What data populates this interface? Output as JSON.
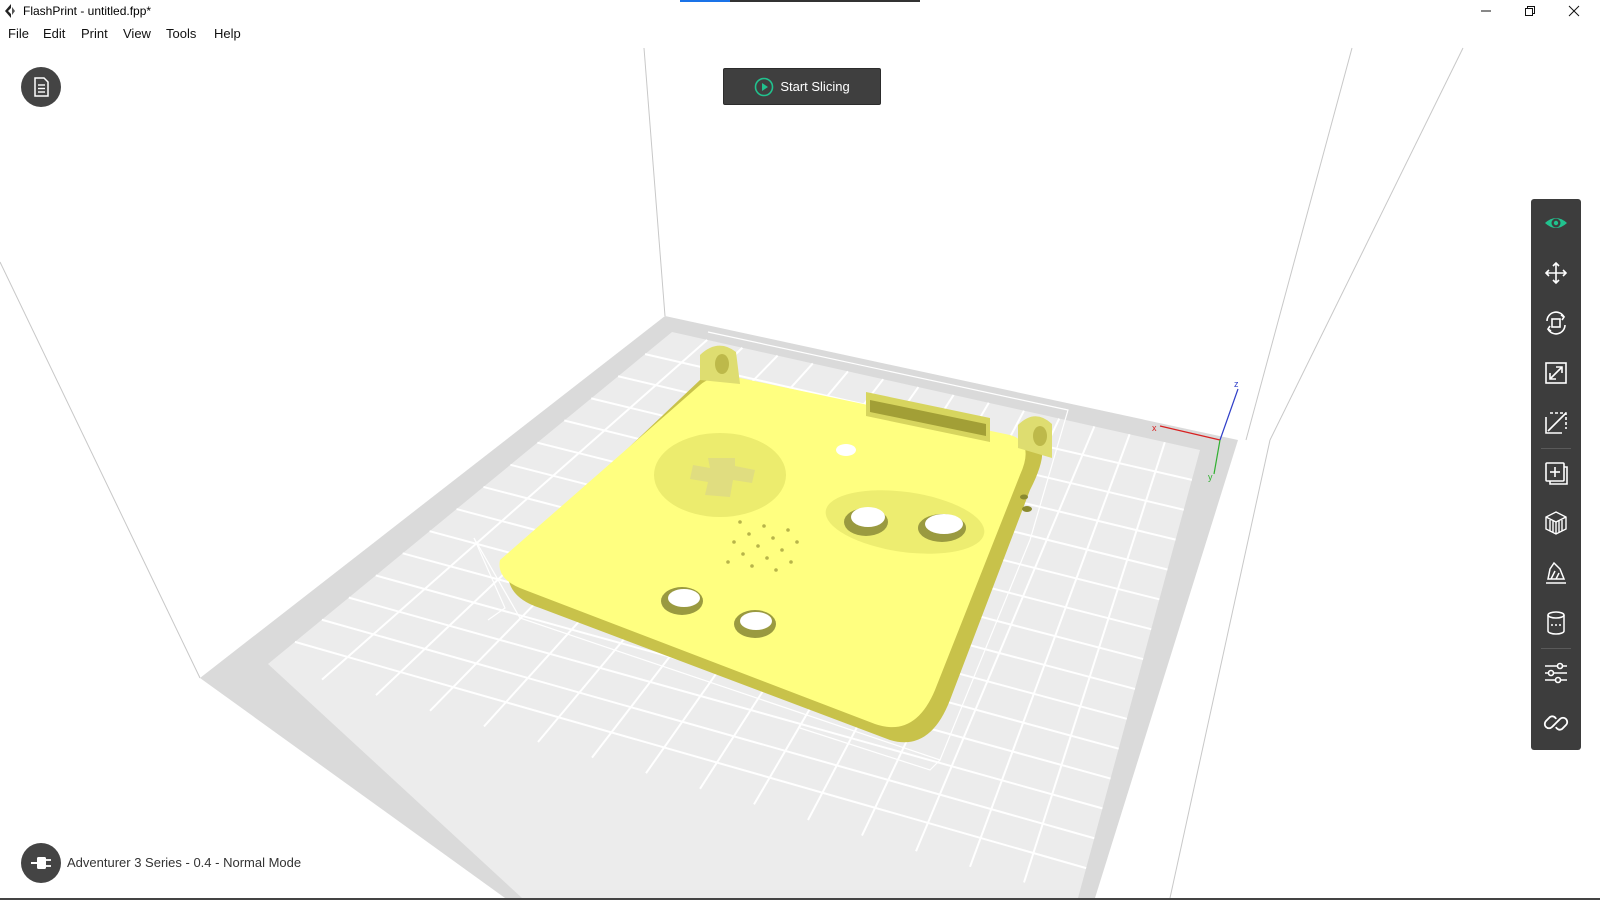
{
  "window": {
    "title": "FlashPrint - untitled.fpp*",
    "controls": {
      "minimize": "minimize",
      "restore": "restore",
      "close": "close"
    }
  },
  "menu": [
    {
      "label": "File"
    },
    {
      "label": "Edit"
    },
    {
      "label": "Print"
    },
    {
      "label": "View"
    },
    {
      "label": "Tools"
    },
    {
      "label": "Help"
    }
  ],
  "actions": {
    "start_slicing": "Start Slicing"
  },
  "toolbar": [
    {
      "name": "view-icon",
      "tooltip": "View"
    },
    {
      "name": "move-icon",
      "tooltip": "Move"
    },
    {
      "name": "rotate-icon",
      "tooltip": "Rotate"
    },
    {
      "name": "scale-icon",
      "tooltip": "Scale"
    },
    {
      "name": "cut-icon",
      "tooltip": "Cut"
    },
    {
      "name": "add-model-icon",
      "tooltip": "Add"
    },
    {
      "name": "supports-icon",
      "tooltip": "Supports"
    },
    {
      "name": "print-bed-icon",
      "tooltip": "Platform"
    },
    {
      "name": "cylinder-icon",
      "tooltip": "Cylinder"
    },
    {
      "name": "settings-sliders-icon",
      "tooltip": "Settings"
    },
    {
      "name": "link-icon",
      "tooltip": "Link"
    }
  ],
  "axes": {
    "x": "x",
    "y": "y",
    "z": "z"
  },
  "status": {
    "printer": "Adventurer 3 Series - 0.4 - Normal Mode"
  },
  "colors": {
    "accent": "#21c28e",
    "model": "#ffff80",
    "toolbar_bg": "#3d3d3d",
    "button_bg": "#3f3f3f"
  }
}
